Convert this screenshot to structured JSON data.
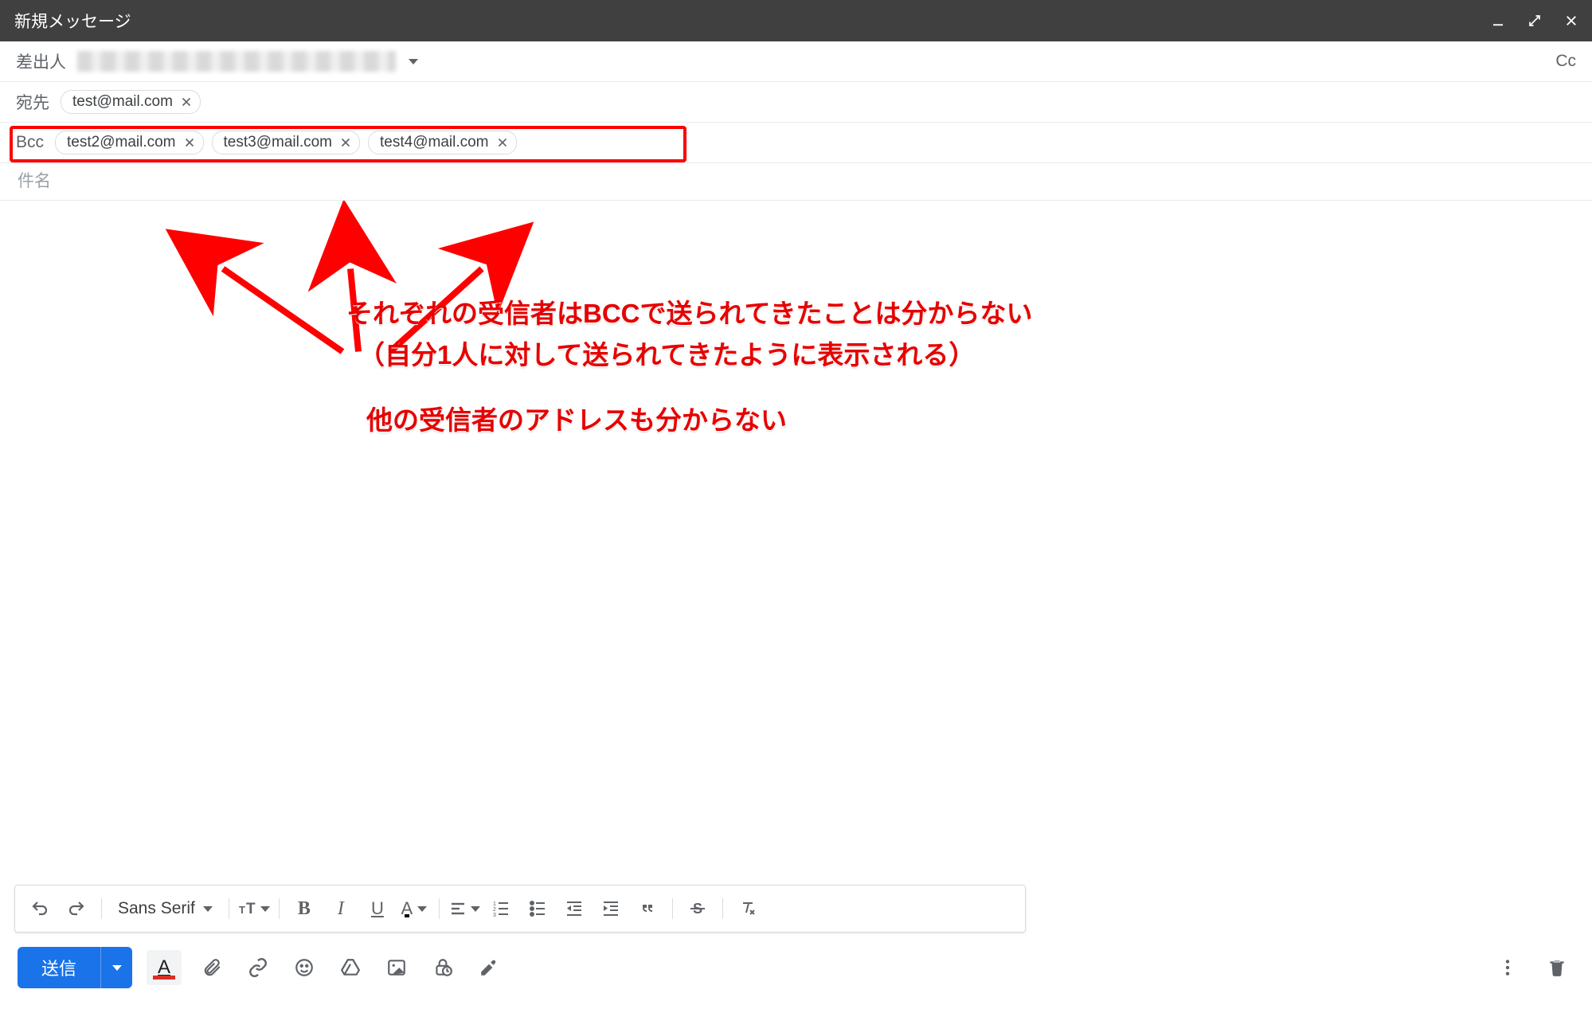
{
  "window": {
    "title": "新規メッセージ"
  },
  "from": {
    "label": "差出人"
  },
  "to": {
    "label": "宛先",
    "chips": [
      "test@mail.com"
    ]
  },
  "cc_label": "Cc",
  "bcc": {
    "label": "Bcc",
    "chips": [
      "test2@mail.com",
      "test3@mail.com",
      "test4@mail.com"
    ]
  },
  "subject": {
    "label": "件名",
    "value": ""
  },
  "annotations": {
    "line1": "それぞれの受信者はBCCで送られてきたことは分からない",
    "line2": "（自分1人に対して送られてきたように表示される）",
    "line3": "他の受信者のアドレスも分からない"
  },
  "format": {
    "font": "Sans Serif"
  },
  "actions": {
    "send": "送信"
  }
}
